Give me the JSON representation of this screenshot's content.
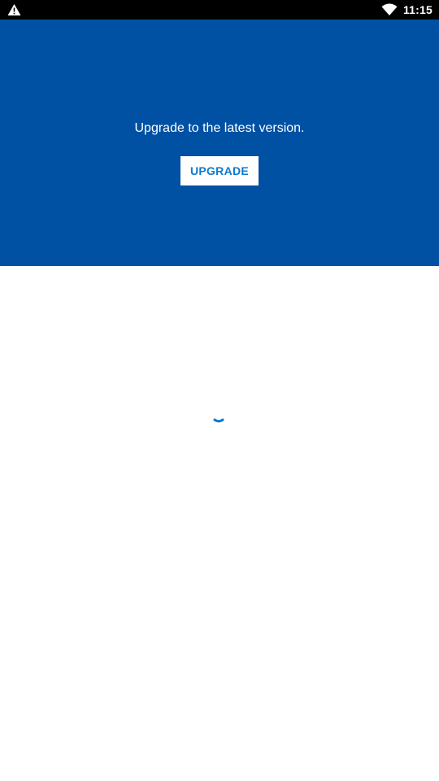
{
  "status_bar": {
    "time": "11:15",
    "icons": [
      "warning-icon",
      "wifi-icon"
    ]
  },
  "banner": {
    "message": "Upgrade to the latest version.",
    "button_label": "UPGRADE",
    "background_color": "#0051a3",
    "button_text_color": "#0a7ad1"
  },
  "content": {
    "loading_indicator": "spinner-icon",
    "spinner_color": "#0a7ad1"
  }
}
